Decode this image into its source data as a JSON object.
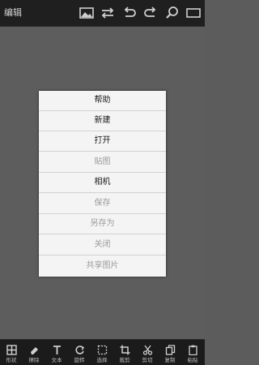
{
  "header": {
    "title": "编辑",
    "icons": [
      "image-icon",
      "swap-icon",
      "undo-icon",
      "redo-icon",
      "zoom-icon",
      "rectangle-icon"
    ]
  },
  "menu": {
    "items": [
      {
        "label": "帮助",
        "enabled": true
      },
      {
        "label": "新建",
        "enabled": true
      },
      {
        "label": "打开",
        "enabled": true
      },
      {
        "label": "贴图",
        "enabled": false
      },
      {
        "label": "相机",
        "enabled": true
      },
      {
        "label": "保存",
        "enabled": false
      },
      {
        "label": "另存为",
        "enabled": false
      },
      {
        "label": "关闭",
        "enabled": false
      },
      {
        "label": "共享图片",
        "enabled": false
      }
    ]
  },
  "toolbar": {
    "items": [
      {
        "label": "形状",
        "icon": "shape-grid-icon"
      },
      {
        "label": "擦除",
        "icon": "eraser-icon"
      },
      {
        "label": "文本",
        "icon": "text-icon"
      },
      {
        "label": "旋转",
        "icon": "rotate-icon"
      },
      {
        "label": "选择",
        "icon": "select-icon"
      },
      {
        "label": "裁剪",
        "icon": "crop-icon"
      },
      {
        "label": "剪切",
        "icon": "scissors-icon"
      },
      {
        "label": "复制",
        "icon": "copy-icon"
      },
      {
        "label": "粘贴",
        "icon": "paste-icon"
      }
    ]
  },
  "colors": {
    "topbar": "#1f1f1f",
    "canvas": "#5d5d5d",
    "menu_bg": "#f4f4f4",
    "enabled_text": "#1a1a1a",
    "disabled_text": "#9a9a9a",
    "bottombar": "#1b1b1b"
  }
}
